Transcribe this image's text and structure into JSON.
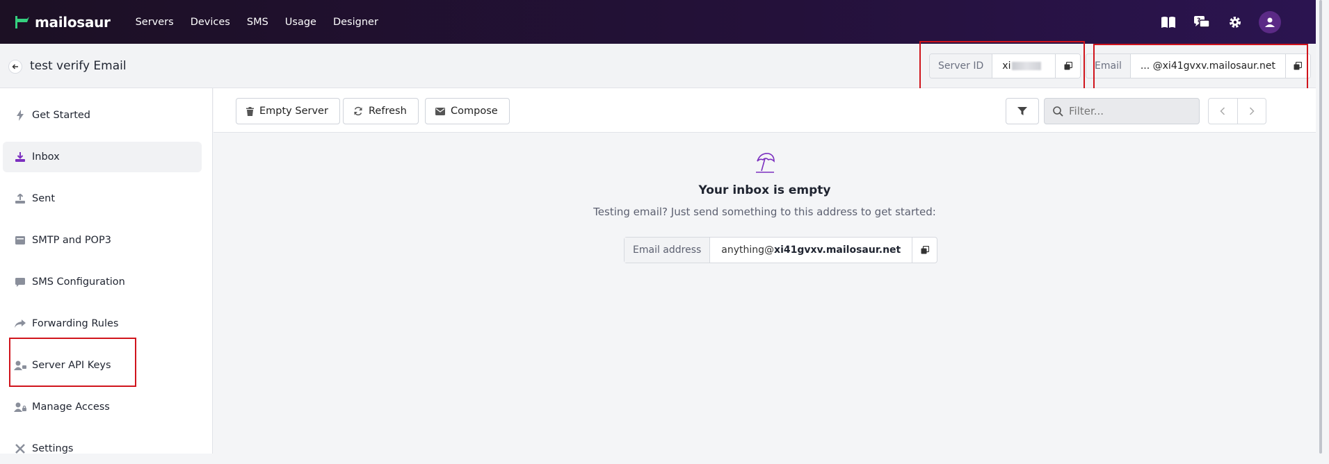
{
  "nav": {
    "brand": "mailosaur",
    "links": [
      "Servers",
      "Devices",
      "SMS",
      "Usage",
      "Designer"
    ],
    "right_icons": [
      "book-icon",
      "help-chat-icon",
      "gear-icon",
      "user-avatar-icon"
    ]
  },
  "header": {
    "title": "test verify Email",
    "server_id_label": "Server ID",
    "server_id_value": "xi",
    "email_label": "Email",
    "email_value": "... @xi41gvxv.mailosaur.net"
  },
  "sidebar": {
    "items": [
      {
        "label": "Get Started",
        "icon": "bolt-icon"
      },
      {
        "label": "Inbox",
        "icon": "inbox-download-icon"
      },
      {
        "label": "Sent",
        "icon": "upload-icon"
      },
      {
        "label": "SMTP and POP3",
        "icon": "server-icon"
      },
      {
        "label": "SMS Configuration",
        "icon": "chat-bubble-icon"
      },
      {
        "label": "Forwarding Rules",
        "icon": "forward-icon"
      },
      {
        "label": "Server API Keys",
        "icon": "user-key-icon"
      },
      {
        "label": "Manage Access",
        "icon": "user-lock-icon"
      },
      {
        "label": "Settings",
        "icon": "tools-icon"
      }
    ]
  },
  "toolbar": {
    "empty_label": "Empty Server",
    "refresh_label": "Refresh",
    "compose_label": "Compose",
    "filter_placeholder": "Filter..."
  },
  "empty_state": {
    "icon": "beach-umbrella-icon",
    "title": "Your inbox is empty",
    "subtitle": "Testing email? Just send something to this address to get started:",
    "address_label": "Email address",
    "address_prefix": "anything@",
    "address_domain": "xi41gvxv.mailosaur.net"
  },
  "colors": {
    "nav_bg": "#24113a",
    "accent": "#7b2fbf",
    "highlight_box": "#d0141c"
  }
}
